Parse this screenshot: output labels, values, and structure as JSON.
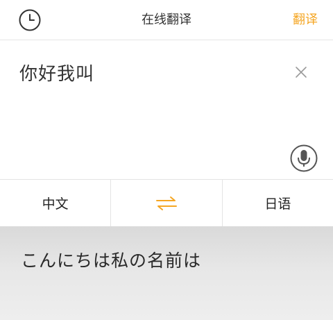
{
  "header": {
    "title": "在线翻译",
    "translate_label": "翻译",
    "history_icon": "clock-icon"
  },
  "input": {
    "text": "你好我叫",
    "clear_icon": "close-icon",
    "mic_icon": "microphone-icon"
  },
  "languages": {
    "source": "中文",
    "target": "日语",
    "swap_icon": "swap-arrows-icon"
  },
  "result": {
    "text": "こんにちは私の名前は"
  },
  "colors": {
    "accent": "#f5a623",
    "result_background": "#e3e3e3"
  }
}
